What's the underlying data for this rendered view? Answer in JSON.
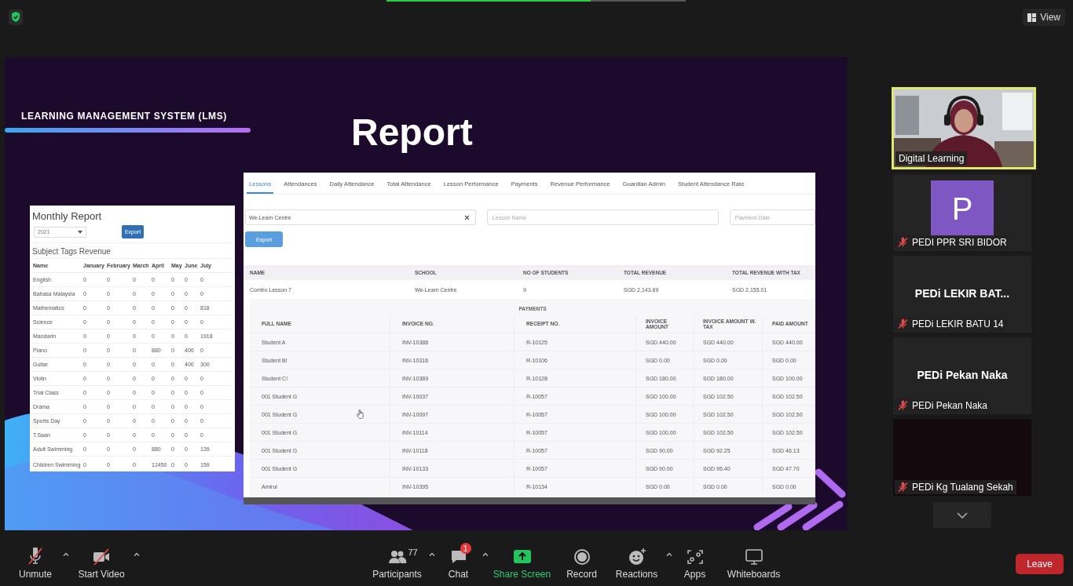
{
  "top_bar": {
    "view_label": "View"
  },
  "slide": {
    "header": "LEARNING MANAGEMENT SYSTEM (LMS)",
    "title": "Report",
    "monthly_report": {
      "title": "Monthly Report",
      "year": "2021",
      "export": "Export",
      "section": "Subject Tags Revenue",
      "columns": [
        "Name",
        "January",
        "February",
        "March",
        "April",
        "May",
        "June",
        "July"
      ],
      "rows": [
        {
          "name": "English",
          "values": [
            "0",
            "0",
            "0",
            "0",
            "0",
            "0",
            "0"
          ]
        },
        {
          "name": "Bahasa Malaysia",
          "values": [
            "0",
            "0",
            "0",
            "0",
            "0",
            "0",
            "0"
          ]
        },
        {
          "name": "Mathematics",
          "values": [
            "0",
            "0",
            "0",
            "0",
            "0",
            "0",
            "818"
          ]
        },
        {
          "name": "Science",
          "values": [
            "0",
            "0",
            "0",
            "0",
            "0",
            "0",
            "0"
          ]
        },
        {
          "name": "Mandarin",
          "values": [
            "0",
            "0",
            "0",
            "0",
            "0",
            "0",
            "1918"
          ]
        },
        {
          "name": "Piano",
          "values": [
            "0",
            "0",
            "0",
            "880",
            "0",
            "400",
            "0"
          ]
        },
        {
          "name": "Guitar",
          "values": [
            "0",
            "0",
            "0",
            "0",
            "0",
            "400",
            "300"
          ]
        },
        {
          "name": "Violin",
          "values": [
            "0",
            "0",
            "0",
            "0",
            "0",
            "0",
            "0"
          ]
        },
        {
          "name": "Trial Class",
          "values": [
            "0",
            "0",
            "0",
            "0",
            "0",
            "0",
            "0"
          ]
        },
        {
          "name": "Drama",
          "values": [
            "0",
            "0",
            "0",
            "0",
            "0",
            "0",
            "0"
          ]
        },
        {
          "name": "Sports Day",
          "values": [
            "0",
            "0",
            "0",
            "0",
            "0",
            "0",
            "0"
          ]
        },
        {
          "name": "T.Saan",
          "values": [
            "0",
            "0",
            "0",
            "0",
            "0",
            "0",
            "0"
          ]
        },
        {
          "name": "Adult Swimming",
          "values": [
            "0",
            "0",
            "0",
            "880",
            "0",
            "0",
            "139"
          ]
        },
        {
          "name": "Children Swimming",
          "values": [
            "0",
            "0",
            "0",
            "12450",
            "0",
            "0",
            "159"
          ]
        }
      ]
    },
    "lms": {
      "tabs": [
        {
          "label": "Lessons",
          "selected": true
        },
        {
          "label": "Attendances",
          "selected": false
        },
        {
          "label": "Daily Attendance",
          "selected": false
        },
        {
          "label": "Total Attendance",
          "selected": false
        },
        {
          "label": "Lesson Performance",
          "selected": false
        },
        {
          "label": "Payments",
          "selected": false
        },
        {
          "label": "Revenue Performance",
          "selected": false
        },
        {
          "label": "Guardian Admin",
          "selected": false
        },
        {
          "label": "Student Attendance Rate",
          "selected": false
        }
      ],
      "school_value": "We-Learn Centre",
      "lesson_placeholder": "Lesson Name",
      "date_placeholder": "Payment Date",
      "export": "Export",
      "lesson_columns": [
        "NAME",
        "SCHOOL",
        "NO OF STUDENTS",
        "TOTAL REVENUE",
        "TOTAL REVENUE WITH TAX"
      ],
      "lesson_row": [
        "Combo Lesson 7",
        "We-Learn Centre",
        "9",
        "SGD 2,143.69",
        "SGD 2,155.01"
      ],
      "payments_title": "PAYMENTS",
      "payment_columns": [
        "FULL NAME",
        "INVOICE NO.",
        "RECEIPT NO.",
        "INVOICE AMOUNT",
        "INVOICE AMOUNT W. TAX",
        "PAID AMOUNT"
      ],
      "payment_rows": [
        [
          "Student A",
          "INV-10388",
          "R-10125",
          "SGD 440.00",
          "SGD 440.00",
          "SGD 440.00"
        ],
        [
          "Student B!",
          "INV-10316",
          "R-10106",
          "SGD 0.00",
          "SGD 0.00",
          "SGD 0.00"
        ],
        [
          "Student C!",
          "INV-10389",
          "R-10128",
          "SGD 180.00",
          "SGD 180.00",
          "SGD 100.00"
        ],
        [
          "001 Student G",
          "INV-10037",
          "R-10057",
          "SGD 100.00",
          "SGD 102.50",
          "SGD 102.50"
        ],
        [
          "001 Student G",
          "INV-10097",
          "R-10057",
          "SGD 100.00",
          "SGD 102.50",
          "SGD 102.50"
        ],
        [
          "001 Student G",
          "INV-10114",
          "R-10057",
          "SGD 100.00",
          "SGD 102.50",
          "SGD 102.50"
        ],
        [
          "001 Student G",
          "INV-10118",
          "R-10057",
          "SGD 90.00",
          "SGD 92.25",
          "SGD 46.13"
        ],
        [
          "001 Student G",
          "INV-10133",
          "R-10057",
          "SGD 90.00",
          "SGD 95.40",
          "SGD 47.70"
        ],
        [
          "Amirul",
          "INV-10395",
          "R-10134",
          "SGD 0.00",
          "SGD 0.00",
          "SGD 0.00"
        ]
      ]
    }
  },
  "participants": [
    {
      "kind": "camera",
      "name": "Digital Learning",
      "muted": false,
      "active": true
    },
    {
      "kind": "avatar",
      "initial": "P",
      "name": "PEDI PPR SRI BIDOR",
      "muted": true,
      "active": false
    },
    {
      "kind": "name",
      "display": "PEDi LEKIR BAT...",
      "name": "PEDi LEKIR BATU 14",
      "muted": true,
      "active": false
    },
    {
      "kind": "name",
      "display": "PEDi Pekan Naka",
      "name": "PEDi Pekan Naka",
      "muted": true,
      "active": false
    },
    {
      "kind": "dark",
      "name": "PEDi Kg Tualang Sekah",
      "muted": true,
      "active": false
    }
  ],
  "toolbar": {
    "items": [
      {
        "kind": "mic",
        "label": "Unmute",
        "caret": true
      },
      {
        "kind": "video",
        "label": "Start Video",
        "caret": true
      },
      {
        "kind": "participants",
        "label": "Participants",
        "count": "77",
        "caret": true
      },
      {
        "kind": "chat",
        "label": "Chat",
        "badge": "1",
        "caret": true
      },
      {
        "kind": "share",
        "label": "Share Screen",
        "caret": false
      },
      {
        "kind": "record",
        "label": "Record",
        "caret": false
      },
      {
        "kind": "reactions",
        "label": "Reactions",
        "caret": true
      },
      {
        "kind": "apps",
        "label": "Apps",
        "caret": false
      },
      {
        "kind": "whiteboards",
        "label": "Whiteboards",
        "caret": false
      }
    ],
    "leave": "Leave"
  }
}
